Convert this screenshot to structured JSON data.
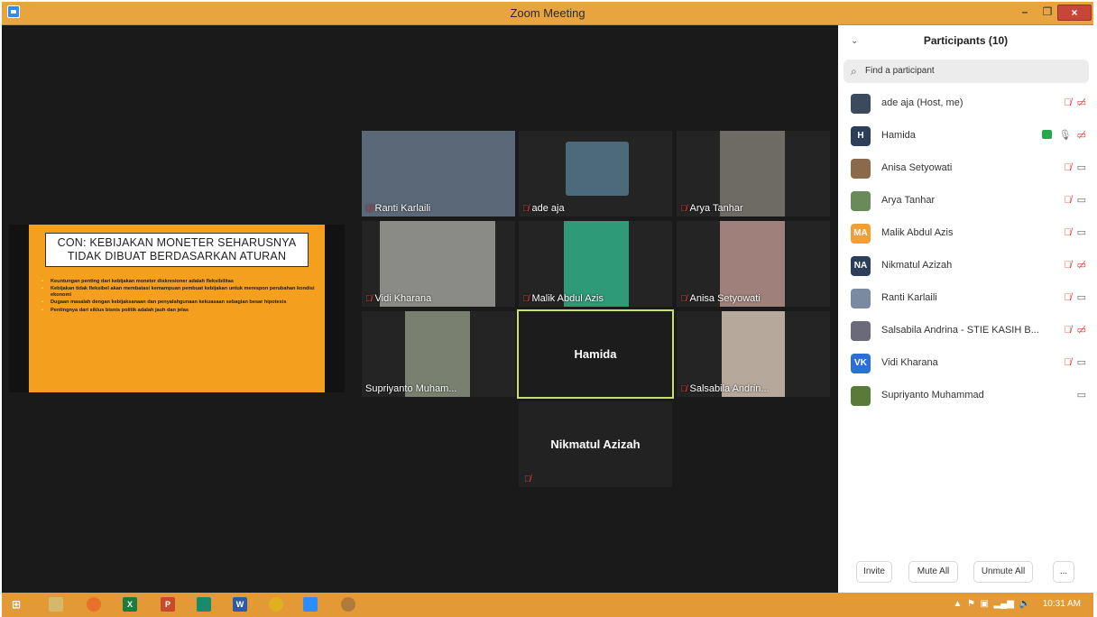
{
  "window": {
    "title": "Zoom Meeting"
  },
  "share": {
    "slide_title_line1": "CON: KEBIJAKAN MONETER SEHARUSNYA",
    "slide_title_line2": "TIDAK DIBUAT BERDASARKAN ATURAN",
    "bullets": [
      "Keuntungan penting dari kebijakan moneter diskresioner adalah fleksibilitas",
      "Kebijakan tidak fleksibel akan membatasi kemampuan pembuat kebijakan untuk merespon perubahan kondisi ekonomi",
      "Dugaan masalah dengan kebijaksanaan dan penyalahgunaan kekuasaan sebagian besar hipotesis",
      "Pentingnya dari siklus bisnis politik adalah jauh dan jelas"
    ]
  },
  "tiles": [
    {
      "name": "Ranti Karlaili",
      "muted": true
    },
    {
      "name": "ade aja",
      "muted": true
    },
    {
      "name": "Arya Tanhar",
      "muted": true
    },
    {
      "name": "Vidi Kharana",
      "muted": true
    },
    {
      "name": "Malik Abdul Azis",
      "muted": true
    },
    {
      "name": "Anisa Setyowati",
      "muted": true
    },
    {
      "name": "Supriyanto Muham...",
      "muted": false
    },
    {
      "name": "Hamida",
      "muted": false
    },
    {
      "name": "Salsabila Andrin...",
      "muted": true
    },
    {
      "name": "Nikmatul Azizah",
      "muted": true
    }
  ],
  "participants": {
    "header": "Participants (10)",
    "search_placeholder": "Find a participant",
    "list": [
      {
        "initials": "",
        "name": "ade aja (Host, me)",
        "avatar_color": "#3b4a5c"
      },
      {
        "initials": "H",
        "name": "Hamida",
        "avatar_color": "#2d3e5a"
      },
      {
        "initials": "",
        "name": "Anisa Setyowati",
        "avatar_color": "#8a6a4a"
      },
      {
        "initials": "",
        "name": "Arya Tanhar",
        "avatar_color": "#6a8a5a"
      },
      {
        "initials": "MA",
        "name": "Malik Abdul Azis",
        "avatar_color": "#f0a030"
      },
      {
        "initials": "NA",
        "name": "Nikmatul Azizah",
        "avatar_color": "#2d3e5a"
      },
      {
        "initials": "",
        "name": "Ranti Karlaili",
        "avatar_color": "#7a8aa0"
      },
      {
        "initials": "",
        "name": "Salsabila Andrina - STIE KASIH B...",
        "avatar_color": "#6a6a7a"
      },
      {
        "initials": "VK",
        "name": "Vidi Kharana",
        "avatar_color": "#2d6fd8"
      },
      {
        "initials": "",
        "name": "Supriyanto Muhammad",
        "avatar_color": "#5a7a3a"
      }
    ],
    "invite_label": "Invite",
    "mute_all_label": "Mute All",
    "unmute_all_label": "Unmute All",
    "more_label": "..."
  },
  "taskbar": {
    "clock": "10:31 AM",
    "apps": [
      "firefox",
      "excel",
      "powerpoint",
      "publisher",
      "word",
      "chrome",
      "zoom",
      "sync"
    ]
  },
  "colors": {
    "accent": "#e8a43e",
    "slide_bg": "#f4a01e",
    "mute_red": "#e0413a",
    "active_border": "#c7e06a"
  }
}
